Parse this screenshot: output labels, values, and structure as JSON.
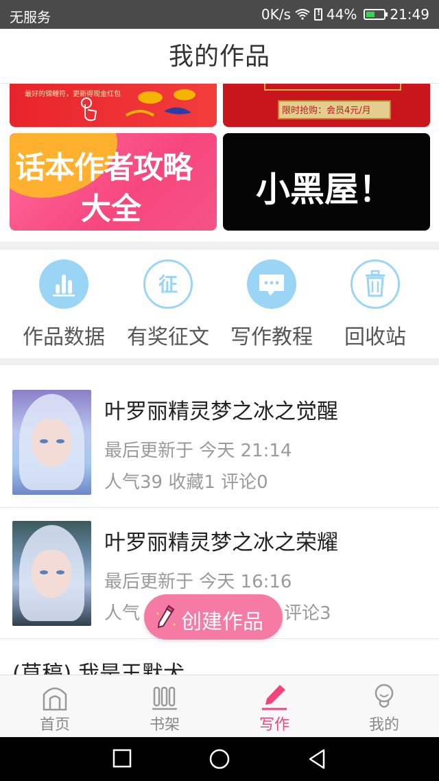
{
  "status_bar": {
    "carrier": "无服务",
    "speed": "0K/s",
    "battery": "44%",
    "time": "21:49"
  },
  "header": {
    "title": "我的作品"
  },
  "banners": {
    "top_left_caption": "最好的锦鲤符，更新得现金红包",
    "top_right_caption": "限时抢购：会员4元/月",
    "strategy_line1": "话本作者攻略",
    "strategy_line2": "大全",
    "blackroom": "小黑屋！"
  },
  "quick_menu": [
    {
      "label": "作品数据",
      "icon": "chart-icon"
    },
    {
      "label": "有奖征文",
      "icon": "contest-icon",
      "glyph": "征"
    },
    {
      "label": "写作教程",
      "icon": "chat-bubble-icon"
    },
    {
      "label": "回收站",
      "icon": "trash-icon"
    }
  ],
  "works": [
    {
      "title": "叶罗丽精灵梦之冰之觉醒",
      "updated": "最后更新于 今天 21:14",
      "stats": "人气39 收藏1 评论0"
    },
    {
      "title": "叶罗丽精灵梦之冰之荣耀",
      "updated": "最后更新于 今天 16:16",
      "stats_left": "人气",
      "stats_right": "评论3"
    }
  ],
  "draft": {
    "title": "(草稿) 我是王默犬"
  },
  "create_button": {
    "label": "创建作品"
  },
  "tabs": [
    {
      "label": "首页",
      "icon": "home-icon",
      "active": false
    },
    {
      "label": "书架",
      "icon": "bookshelf-icon",
      "active": false
    },
    {
      "label": "写作",
      "icon": "pencil-icon",
      "active": true
    },
    {
      "label": "我的",
      "icon": "profile-icon",
      "active": false
    }
  ],
  "colors": {
    "accent": "#f2447c",
    "quick_icon": "#9ad5f5",
    "create_button": "#f57aa4"
  }
}
